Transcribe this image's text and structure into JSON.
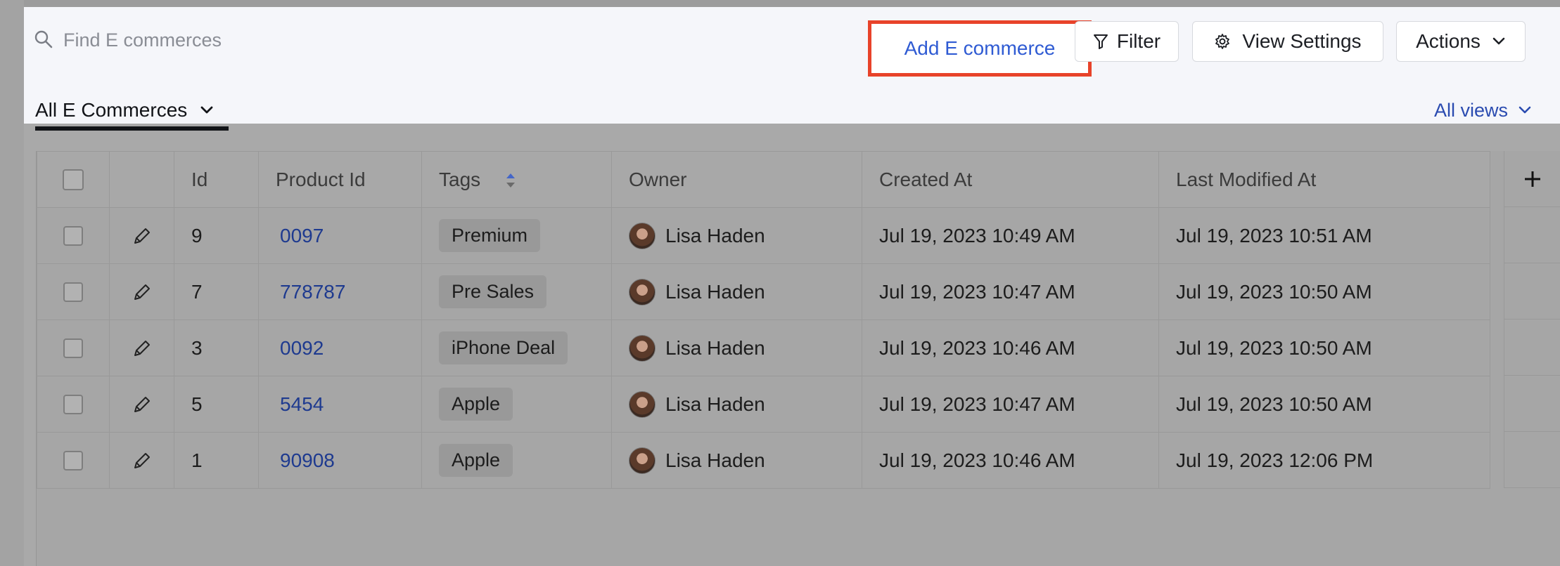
{
  "toolbar": {
    "search_placeholder": "Find E commerces",
    "add_label": "Add E commerce",
    "filter_label": "Filter",
    "view_settings_label": "View Settings",
    "actions_label": "Actions"
  },
  "views": {
    "current": "All E Commerces",
    "all_views_label": "All views"
  },
  "table": {
    "headers": {
      "id": "Id",
      "product_id": "Product Id",
      "tags": "Tags",
      "owner": "Owner",
      "created_at": "Created At",
      "last_modified_at": "Last Modified At"
    },
    "rows": [
      {
        "id": "9",
        "product_id": "0097",
        "tag": "Premium",
        "owner": "Lisa Haden",
        "created_at": "Jul 19, 2023 10:49 AM",
        "last_modified_at": "Jul 19, 2023 10:51 AM"
      },
      {
        "id": "7",
        "product_id": "778787",
        "tag": "Pre Sales",
        "owner": "Lisa Haden",
        "created_at": "Jul 19, 2023 10:47 AM",
        "last_modified_at": "Jul 19, 2023 10:50 AM"
      },
      {
        "id": "3",
        "product_id": "0092",
        "tag": "iPhone Deal",
        "owner": "Lisa Haden",
        "created_at": "Jul 19, 2023 10:46 AM",
        "last_modified_at": "Jul 19, 2023 10:50 AM"
      },
      {
        "id": "5",
        "product_id": "5454",
        "tag": "Apple",
        "owner": "Lisa Haden",
        "created_at": "Jul 19, 2023 10:47 AM",
        "last_modified_at": "Jul 19, 2023 10:50 AM"
      },
      {
        "id": "1",
        "product_id": "90908",
        "tag": "Apple",
        "owner": "Lisa Haden",
        "created_at": "Jul 19, 2023 10:46 AM",
        "last_modified_at": "Jul 19, 2023 12:06 PM"
      }
    ]
  },
  "icons": {
    "search": "search-icon",
    "filter": "filter-icon",
    "settings": "gear-icon",
    "chevron": "chevron-down-icon",
    "edit": "pencil-icon",
    "sort": "sort-icon",
    "add_column": "plus-icon"
  },
  "colors": {
    "highlight": "#e8432a",
    "link": "#2f5bd3",
    "overlay": "#a9a9a9"
  }
}
